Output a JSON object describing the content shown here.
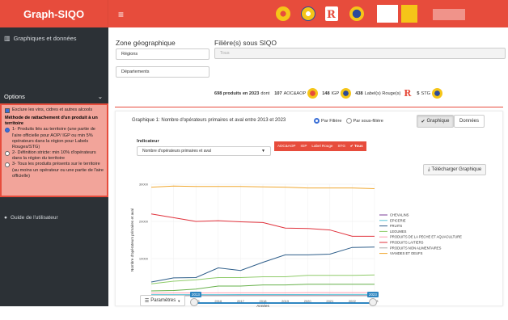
{
  "app": {
    "title": "Graph-SIQO",
    "hamburger": "≡"
  },
  "sidebar": {
    "nav_label": "Graphiques et données",
    "options_label": "Options",
    "options_chevron": "⌄",
    "exclude_label": "Exclure les vins, cidres et autres alcools",
    "method_heading": "Méthode de rattachement d'un produit à un territoire",
    "method_options": [
      "1- Produits liés au territoire (une partie de l'aire officielle pour AOP/ IGP ou min 5% opérateurs dans la région pour Labels Rouges/STG)",
      "2- Définition stricte: min 10% d'opérateurs dans la région du territoire",
      "3- Tous les produits présents sur le territoire (au moins un opérateur ou une partie de l'aire officielle)"
    ],
    "guide_label": "Guide de l'utilisateur"
  },
  "zone": {
    "title": "Zone géographique",
    "regions": "Régions",
    "departements": "Départements"
  },
  "filiere": {
    "title": "Filière(s) sous SIQO",
    "value": "Tous"
  },
  "summary": {
    "intro": "698 produits en 2023",
    "dont": "dont",
    "aop": {
      "count": "107",
      "label": "AOC&AOP"
    },
    "igp": {
      "count": "148",
      "label": "IGP"
    },
    "lr": {
      "count": "438",
      "label": "Label(s) Rouge(s)"
    },
    "stg": {
      "count": "5",
      "label": "STG"
    }
  },
  "graph": {
    "title": "Graphique 1: Nombre d'opérateurs primaires et aval entre 2013 et 2023",
    "radio_filiere": "Par Filière",
    "radio_sousfiliere": "Par sous-filière",
    "btn_graphique": "Graphique",
    "btn_donnees": "Données",
    "indicateur_label": "Indicateur",
    "indicateur_value": "Nombre d'opérateurs primaires et aval",
    "tags": [
      "ADC&AOP",
      "IGP",
      "Label Rouge",
      "STG",
      "✔ Tous"
    ],
    "download_label": "Télécharger Graphique",
    "params_label": "Paramètres",
    "slider_min_label": "2013",
    "slider_max_label": "2023"
  },
  "chart_data": {
    "type": "line",
    "x": [
      2013,
      2014,
      2015,
      2016,
      2017,
      2018,
      2019,
      2020,
      2021,
      2022,
      2023
    ],
    "ylim": [
      0,
      30000
    ],
    "yticks": [
      0,
      10000,
      20000,
      30000
    ],
    "xlabel": "Années",
    "ylabel": "Nombre d'opérateurs primaires et aval",
    "series": [
      {
        "name": "CHEVALINS",
        "color": "#7b3f99",
        "values": [
          40,
          40,
          45,
          45,
          45,
          45,
          45,
          45,
          45,
          45,
          45
        ]
      },
      {
        "name": "EPICERIE",
        "color": "#58c4d8",
        "values": [
          300,
          300,
          310,
          310,
          320,
          320,
          330,
          330,
          340,
          350,
          350
        ]
      },
      {
        "name": "FRUITS",
        "color": "#2e5e8a",
        "values": [
          3700,
          4800,
          4900,
          7500,
          6800,
          9000,
          11000,
          11000,
          11200,
          13000,
          13100
        ]
      },
      {
        "name": "LEGUMES",
        "color": "#8fcb6a",
        "values": [
          3200,
          3900,
          4300,
          4900,
          4900,
          5100,
          5100,
          5500,
          5500,
          5500,
          5600
        ]
      },
      {
        "name": "PRODUITS DE LA PECHE ET AQUACULTURE",
        "color": "#ff9fb1",
        "values": [
          700,
          750,
          750,
          800,
          800,
          800,
          800,
          850,
          850,
          850,
          850
        ]
      },
      {
        "name": "PRODUITS LAITIERS",
        "color": "#e0313b",
        "values": [
          22000,
          21000,
          20000,
          20200,
          19900,
          19700,
          18200,
          18100,
          17700,
          16000,
          16000
        ]
      },
      {
        "name": "PRODUITS NON ALIMENTAIRES",
        "color": "#aaaaaa",
        "values": [
          10,
          10,
          10,
          10,
          10,
          10,
          10,
          10,
          10,
          10,
          10
        ]
      },
      {
        "name": "VIANDES ET OEUFS",
        "color": "#f0a830",
        "values": [
          29200,
          29500,
          29400,
          29400,
          29400,
          29300,
          29200,
          29000,
          29000,
          29000,
          28800
        ]
      },
      {
        "name": "",
        "color": "#66b04a",
        "values": [
          1300,
          1400,
          1800,
          2600,
          2600,
          2900,
          2900,
          3100,
          3100,
          3100,
          3100
        ]
      }
    ]
  }
}
